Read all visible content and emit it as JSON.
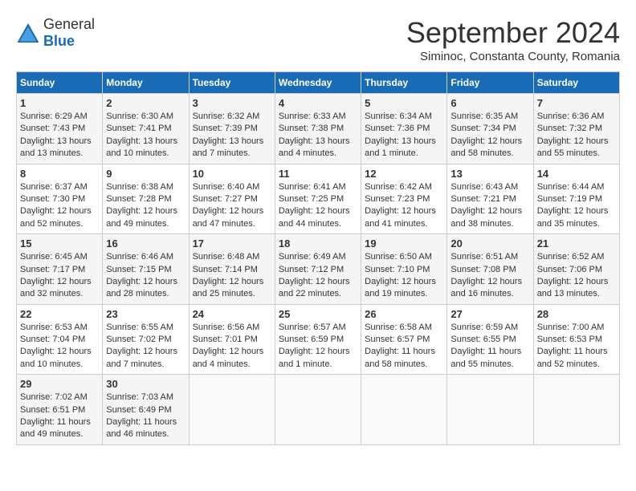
{
  "header": {
    "logo": {
      "general": "General",
      "blue": "Blue",
      "icon_shape": "triangle"
    },
    "title": "September 2024",
    "subtitle": "Siminoc, Constanta County, Romania"
  },
  "weekdays": [
    "Sunday",
    "Monday",
    "Tuesday",
    "Wednesday",
    "Thursday",
    "Friday",
    "Saturday"
  ],
  "weeks": [
    [
      {
        "day": "1",
        "info": "Sunrise: 6:29 AM\nSunset: 7:43 PM\nDaylight: 13 hours\nand 13 minutes."
      },
      {
        "day": "2",
        "info": "Sunrise: 6:30 AM\nSunset: 7:41 PM\nDaylight: 13 hours\nand 10 minutes."
      },
      {
        "day": "3",
        "info": "Sunrise: 6:32 AM\nSunset: 7:39 PM\nDaylight: 13 hours\nand 7 minutes."
      },
      {
        "day": "4",
        "info": "Sunrise: 6:33 AM\nSunset: 7:38 PM\nDaylight: 13 hours\nand 4 minutes."
      },
      {
        "day": "5",
        "info": "Sunrise: 6:34 AM\nSunset: 7:36 PM\nDaylight: 13 hours\nand 1 minute."
      },
      {
        "day": "6",
        "info": "Sunrise: 6:35 AM\nSunset: 7:34 PM\nDaylight: 12 hours\nand 58 minutes."
      },
      {
        "day": "7",
        "info": "Sunrise: 6:36 AM\nSunset: 7:32 PM\nDaylight: 12 hours\nand 55 minutes."
      }
    ],
    [
      {
        "day": "8",
        "info": "Sunrise: 6:37 AM\nSunset: 7:30 PM\nDaylight: 12 hours\nand 52 minutes."
      },
      {
        "day": "9",
        "info": "Sunrise: 6:38 AM\nSunset: 7:28 PM\nDaylight: 12 hours\nand 49 minutes."
      },
      {
        "day": "10",
        "info": "Sunrise: 6:40 AM\nSunset: 7:27 PM\nDaylight: 12 hours\nand 47 minutes."
      },
      {
        "day": "11",
        "info": "Sunrise: 6:41 AM\nSunset: 7:25 PM\nDaylight: 12 hours\nand 44 minutes."
      },
      {
        "day": "12",
        "info": "Sunrise: 6:42 AM\nSunset: 7:23 PM\nDaylight: 12 hours\nand 41 minutes."
      },
      {
        "day": "13",
        "info": "Sunrise: 6:43 AM\nSunset: 7:21 PM\nDaylight: 12 hours\nand 38 minutes."
      },
      {
        "day": "14",
        "info": "Sunrise: 6:44 AM\nSunset: 7:19 PM\nDaylight: 12 hours\nand 35 minutes."
      }
    ],
    [
      {
        "day": "15",
        "info": "Sunrise: 6:45 AM\nSunset: 7:17 PM\nDaylight: 12 hours\nand 32 minutes."
      },
      {
        "day": "16",
        "info": "Sunrise: 6:46 AM\nSunset: 7:15 PM\nDaylight: 12 hours\nand 28 minutes."
      },
      {
        "day": "17",
        "info": "Sunrise: 6:48 AM\nSunset: 7:14 PM\nDaylight: 12 hours\nand 25 minutes."
      },
      {
        "day": "18",
        "info": "Sunrise: 6:49 AM\nSunset: 7:12 PM\nDaylight: 12 hours\nand 22 minutes."
      },
      {
        "day": "19",
        "info": "Sunrise: 6:50 AM\nSunset: 7:10 PM\nDaylight: 12 hours\nand 19 minutes."
      },
      {
        "day": "20",
        "info": "Sunrise: 6:51 AM\nSunset: 7:08 PM\nDaylight: 12 hours\nand 16 minutes."
      },
      {
        "day": "21",
        "info": "Sunrise: 6:52 AM\nSunset: 7:06 PM\nDaylight: 12 hours\nand 13 minutes."
      }
    ],
    [
      {
        "day": "22",
        "info": "Sunrise: 6:53 AM\nSunset: 7:04 PM\nDaylight: 12 hours\nand 10 minutes."
      },
      {
        "day": "23",
        "info": "Sunrise: 6:55 AM\nSunset: 7:02 PM\nDaylight: 12 hours\nand 7 minutes."
      },
      {
        "day": "24",
        "info": "Sunrise: 6:56 AM\nSunset: 7:01 PM\nDaylight: 12 hours\nand 4 minutes."
      },
      {
        "day": "25",
        "info": "Sunrise: 6:57 AM\nSunset: 6:59 PM\nDaylight: 12 hours\nand 1 minute."
      },
      {
        "day": "26",
        "info": "Sunrise: 6:58 AM\nSunset: 6:57 PM\nDaylight: 11 hours\nand 58 minutes."
      },
      {
        "day": "27",
        "info": "Sunrise: 6:59 AM\nSunset: 6:55 PM\nDaylight: 11 hours\nand 55 minutes."
      },
      {
        "day": "28",
        "info": "Sunrise: 7:00 AM\nSunset: 6:53 PM\nDaylight: 11 hours\nand 52 minutes."
      }
    ],
    [
      {
        "day": "29",
        "info": "Sunrise: 7:02 AM\nSunset: 6:51 PM\nDaylight: 11 hours\nand 49 minutes."
      },
      {
        "day": "30",
        "info": "Sunrise: 7:03 AM\nSunset: 6:49 PM\nDaylight: 11 hours\nand 46 minutes."
      },
      {
        "day": "",
        "info": ""
      },
      {
        "day": "",
        "info": ""
      },
      {
        "day": "",
        "info": ""
      },
      {
        "day": "",
        "info": ""
      },
      {
        "day": "",
        "info": ""
      }
    ]
  ]
}
